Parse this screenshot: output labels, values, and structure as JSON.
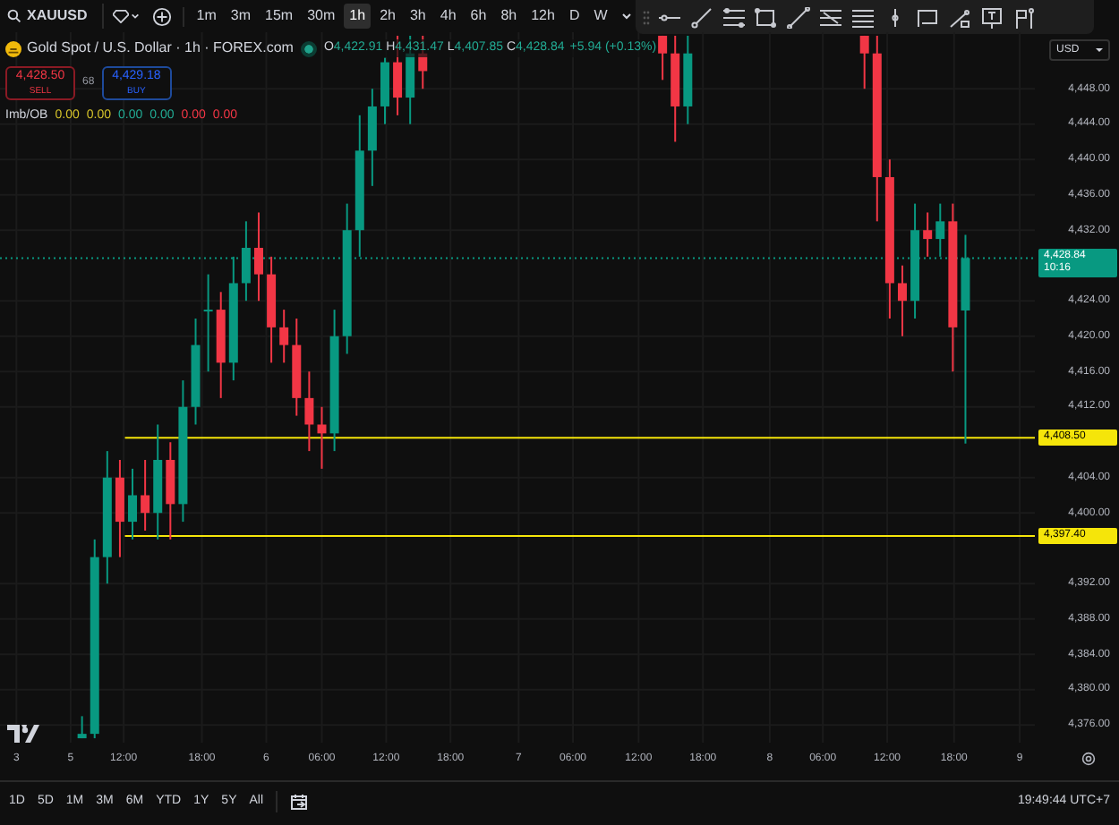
{
  "symbol_search": {
    "value": "XAUUSD"
  },
  "intervals": [
    {
      "label": "1m",
      "selected": false
    },
    {
      "label": "3m",
      "selected": false
    },
    {
      "label": "15m",
      "selected": false
    },
    {
      "label": "30m",
      "selected": false
    },
    {
      "label": "1h",
      "selected": true
    },
    {
      "label": "2h",
      "selected": false
    },
    {
      "label": "3h",
      "selected": false
    },
    {
      "label": "4h",
      "selected": false
    },
    {
      "label": "6h",
      "selected": false
    },
    {
      "label": "8h",
      "selected": false
    },
    {
      "label": "12h",
      "selected": false
    },
    {
      "label": "D",
      "selected": false
    },
    {
      "label": "W",
      "selected": false
    }
  ],
  "legend": {
    "title": "Gold Spot / U.S. Dollar · 1h · FOREX.com",
    "ohlc": [
      {
        "key": "O",
        "value": "4,422.91"
      },
      {
        "key": "H",
        "value": "4,431.47"
      },
      {
        "key": "L",
        "value": "4,407.85"
      },
      {
        "key": "C",
        "value": "4,428.84"
      }
    ],
    "change": "+5.94 (+0.13%)"
  },
  "trade": {
    "sell_price": "4,428.50",
    "sell_label": "SELL",
    "spread": "68",
    "buy_price": "4,429.18",
    "buy_label": "BUY"
  },
  "indicator": {
    "name": "Imb/OB",
    "values": [
      {
        "text": "0.00",
        "color": "#d4c22a"
      },
      {
        "text": "0.00",
        "color": "#d4c22a"
      },
      {
        "text": "0.00",
        "color": "#22ab94"
      },
      {
        "text": "0.00",
        "color": "#22ab94"
      },
      {
        "text": "0.00",
        "color": "#f23645"
      },
      {
        "text": "0.00",
        "color": "#f23645"
      }
    ]
  },
  "currency": "USD",
  "chart": {
    "chart_data": {
      "type": "candlestick",
      "categories": [
        null,
        null,
        null,
        null,
        null,
        null,
        null,
        null,
        null,
        null,
        null,
        null,
        null,
        null,
        null,
        null,
        null,
        null,
        null,
        null,
        null,
        null,
        null,
        null,
        null,
        null,
        null,
        null,
        null,
        null,
        null,
        null,
        null,
        null,
        null,
        null,
        null,
        null,
        null,
        null,
        null,
        null,
        null,
        null,
        null,
        null,
        null,
        null,
        null,
        null,
        null,
        null,
        null,
        null,
        null,
        null,
        null,
        null,
        null,
        null,
        null,
        null,
        null,
        null,
        null,
        null,
        null,
        null,
        null,
        null,
        null,
        null,
        null,
        null,
        null,
        null,
        null,
        null,
        null,
        null,
        null,
        null
      ],
      "grid": true,
      "ohlc": [
        null,
        null,
        null,
        null,
        null,
        null,
        [
          4374.5,
          4377,
          4374.5,
          4375
        ],
        [
          4375,
          4397,
          4374.5,
          4395
        ],
        [
          4395,
          4407,
          4392,
          4404
        ],
        [
          4404,
          4406,
          4395,
          4399
        ],
        [
          4399,
          4405,
          4397,
          4402
        ],
        [
          4402,
          4406,
          4398,
          4400
        ],
        [
          4400,
          4410,
          4397,
          4406
        ],
        [
          4406,
          4408,
          4397,
          4401
        ],
        [
          4401,
          4415,
          4399,
          4412
        ],
        [
          4412,
          4422,
          4410,
          4419
        ],
        [
          4423,
          4427,
          4416,
          4423
        ],
        [
          4423,
          4425,
          4413,
          4417
        ],
        [
          4417,
          4429,
          4415,
          4426
        ],
        [
          4426,
          4433,
          4424,
          4430
        ],
        [
          4430,
          4434,
          4424,
          4427
        ],
        [
          4427,
          4429,
          4417,
          4421
        ],
        [
          4421,
          4423,
          4417,
          4419
        ],
        [
          4419,
          4422,
          4411,
          4413
        ],
        [
          4413,
          4416,
          4407,
          4410
        ],
        [
          4410,
          4412,
          4405,
          4409
        ],
        [
          4409,
          4423,
          4407,
          4420
        ],
        [
          4420,
          4435,
          4418,
          4432
        ],
        [
          4432,
          4445,
          4429,
          4441
        ],
        [
          4441,
          4448,
          4437,
          4446
        ],
        [
          4446,
          4451.5,
          4444,
          4451
        ],
        [
          4451,
          4454,
          4445,
          4447
        ],
        [
          4447,
          4454,
          4444,
          4452
        ],
        [
          4452,
          4454,
          4448,
          4450
        ],
        null,
        null,
        null,
        null,
        null,
        null,
        null,
        null,
        null,
        null,
        null,
        null,
        null,
        null,
        null,
        null,
        null,
        null,
        [
          4454,
          4454,
          4449,
          4452
        ],
        [
          4452,
          4454,
          4442,
          4446
        ],
        [
          4446,
          4454,
          4444,
          4452
        ],
        null,
        null,
        null,
        null,
        null,
        null,
        null,
        null,
        null,
        null,
        null,
        null,
        null,
        [
          4454,
          4454,
          4448,
          4452
        ],
        [
          4452,
          4454,
          4433,
          4438
        ],
        [
          4438,
          4440,
          4422,
          4426
        ],
        [
          4426,
          4428,
          4420,
          4424
        ],
        [
          4424,
          4435,
          4422,
          4432
        ],
        [
          4432,
          4434,
          4429,
          4431
        ],
        [
          4431,
          4435,
          4429,
          4433
        ],
        [
          4433,
          4435,
          4416,
          4421
        ],
        [
          4422.91,
          4431.47,
          4407.85,
          4428.84
        ],
        null,
        null,
        null,
        null,
        null
      ],
      "ylim": [
        4374.0,
        4454.4
      ],
      "ref_lines": [
        {
          "axis": "y",
          "value": 4428.84
        },
        {
          "axis": "y",
          "value": 4408.5
        },
        {
          "axis": "y",
          "value": 4397.4
        }
      ],
      "yticks": [
        {
          "value": 4448,
          "label": "4,448.00"
        },
        {
          "value": 4444,
          "label": "4,444.00"
        },
        {
          "value": 4440,
          "label": "4,440.00"
        },
        {
          "value": 4436,
          "label": "4,436.00"
        },
        {
          "value": 4432,
          "label": "4,432.00"
        },
        {
          "value": 4424,
          "label": "4,424.00"
        },
        {
          "value": 4420,
          "label": "4,420.00"
        },
        {
          "value": 4416,
          "label": "4,416.00"
        },
        {
          "value": 4412,
          "label": "4,412.00"
        },
        {
          "value": 4404,
          "label": "4,404.00"
        },
        {
          "value": 4400,
          "label": "4,400.00"
        },
        {
          "value": 4392,
          "label": "4,392.00"
        },
        {
          "value": 4388,
          "label": "4,388.00"
        },
        {
          "value": 4384,
          "label": "4,384.00"
        },
        {
          "value": 4380,
          "label": "4,380.00"
        },
        {
          "value": 4376,
          "label": "4,376.00"
        }
      ],
      "ylabel": null
    },
    "price_labels": [
      {
        "kind": "current",
        "text": "4,428.84",
        "countdown": "10:16"
      },
      {
        "kind": "line",
        "text": "4,408.50"
      },
      {
        "kind": "line",
        "text": "4,397.40"
      }
    ],
    "time_ticks": [
      "3",
      "5",
      "12:00",
      "18:00",
      "6",
      "06:00",
      "12:00",
      "18:00",
      "7",
      "06:00",
      "12:00",
      "18:00",
      "8",
      "06:00",
      "12:00",
      "18:00",
      "9"
    ]
  },
  "ranges": [
    {
      "label": "1D"
    },
    {
      "label": "5D"
    },
    {
      "label": "1M"
    },
    {
      "label": "3M"
    },
    {
      "label": "6M"
    },
    {
      "label": "YTD"
    },
    {
      "label": "1Y"
    },
    {
      "label": "5Y"
    },
    {
      "label": "All"
    }
  ],
  "clock": "19:49:44 UTC+7"
}
